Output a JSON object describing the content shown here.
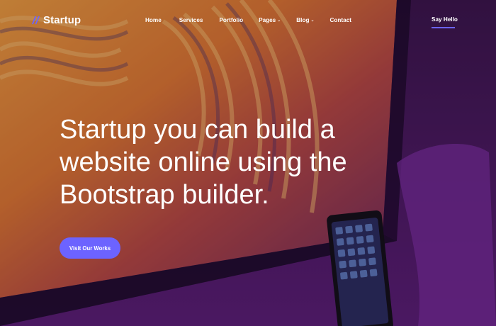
{
  "brand": {
    "name": "Startup",
    "logo_icon": "lightning-slash-icon",
    "logo_color": "#6c63ff"
  },
  "nav": {
    "items": [
      {
        "label": "Home",
        "has_dropdown": false
      },
      {
        "label": "Services",
        "has_dropdown": false
      },
      {
        "label": "Portfolio",
        "has_dropdown": false
      },
      {
        "label": "Pages",
        "has_dropdown": true
      },
      {
        "label": "Blog",
        "has_dropdown": true
      },
      {
        "label": "Contact",
        "has_dropdown": false
      }
    ],
    "cta_label": "Say Hello"
  },
  "hero": {
    "headline_lines": [
      "Startup you can build a",
      "website online using the",
      "Bootstrap builder."
    ],
    "button_label": "Visit Our Works"
  },
  "colors": {
    "accent": "#6c63ff",
    "text": "#ffffff",
    "background": "#2a0f3a"
  }
}
